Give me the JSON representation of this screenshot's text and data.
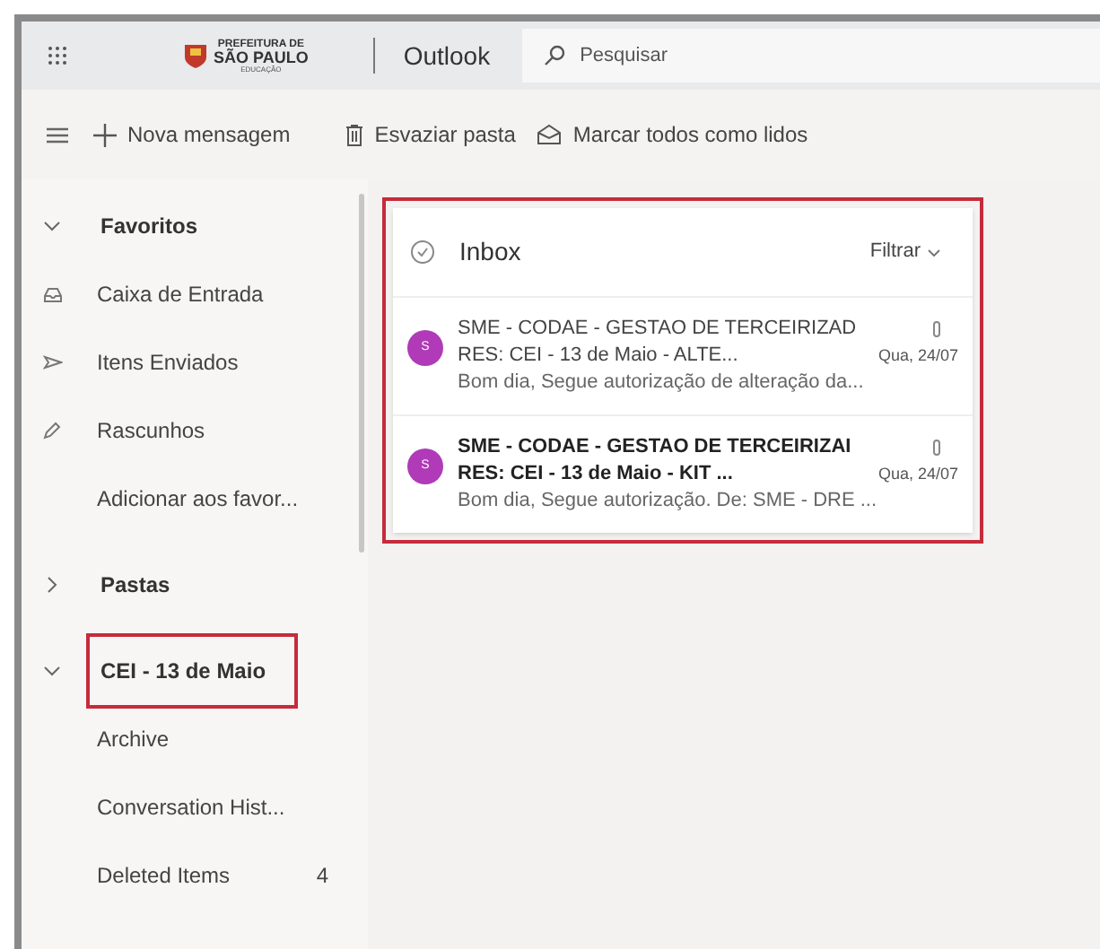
{
  "header": {
    "logo_lines": [
      "PREFEITURA DE",
      "SÃO PAULO",
      "EDUCAÇÃO"
    ],
    "app_name": "Outlook",
    "search": {
      "placeholder": "Pesquisar"
    }
  },
  "toolbar": {
    "new_message": "Nova mensagem",
    "actions": [
      {
        "kind": "trash",
        "label": "Esvaziar pasta"
      },
      {
        "kind": "envelope",
        "label": "Marcar todos como lidos"
      }
    ]
  },
  "sidebar": {
    "sections": [
      {
        "label": "Favoritos",
        "expanded": true,
        "highlighted": false,
        "items": [
          {
            "kind": "inbox",
            "label": "Caixa de Entrada"
          },
          {
            "kind": "sent",
            "label": "Itens Enviados"
          },
          {
            "kind": "drafts",
            "label": "Rascunhos"
          },
          {
            "kind": "plain",
            "label": "Adicionar aos favor..."
          }
        ]
      },
      {
        "label": "Pastas",
        "expanded": false,
        "highlighted": false
      },
      {
        "label": "CEI - 13 de Maio",
        "expanded": true,
        "highlighted": true,
        "items": [
          {
            "kind": "plain",
            "label": "Archive"
          },
          {
            "kind": "plain",
            "label": "Conversation Hist..."
          },
          {
            "kind": "plain",
            "label": "Deleted Items",
            "count": "4"
          }
        ]
      }
    ]
  },
  "message_list": {
    "title": "Inbox",
    "filter": "Filtrar",
    "highlighted": true,
    "messages": [
      {
        "initial": "S",
        "sender": "SME - CODAE - GESTAO DE TERCEIRIZAD",
        "subject": "RES: CEI - 13 de Maio - ALTE...",
        "date": "Qua, 24/07",
        "preview": "Bom dia, Segue autorização de alteração da...",
        "attachment": true,
        "unread": false
      },
      {
        "initial": "S",
        "sender": "SME - CODAE - GESTAO DE TERCEIRIZAI",
        "subject": "RES: CEI - 13 de Maio - KIT ...",
        "date": "Qua, 24/07",
        "preview": "Bom dia, Segue autorização. De: SME - DRE ...",
        "attachment": true,
        "unread": true
      }
    ]
  }
}
